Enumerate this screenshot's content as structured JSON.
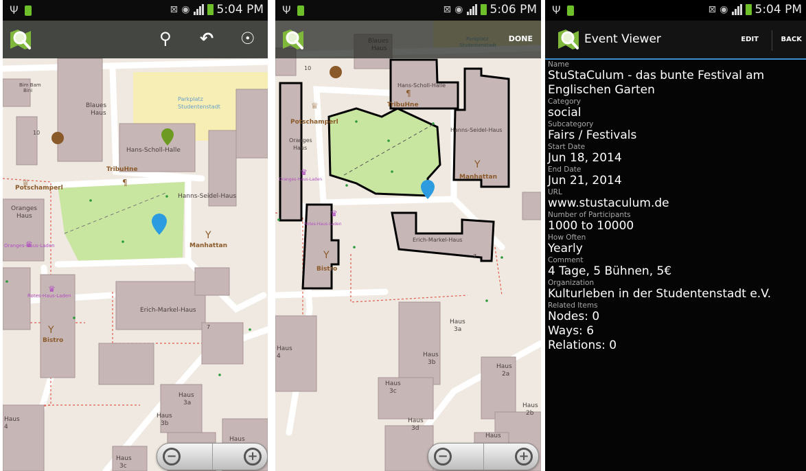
{
  "status_bar": [
    {
      "time": "5:04 PM"
    },
    {
      "time": "5:06 PM"
    },
    {
      "time": "5:04 PM"
    }
  ],
  "editor_toolbar": {
    "done_label": "DONE"
  },
  "map_labels": {
    "bim_bam": "Bim Bam",
    "bim_bam2": "Bini",
    "blaues": "Blaues",
    "haus": "Haus",
    "parkplatz": "Parkplatz",
    "studentenstadt": "Studentenstadt",
    "hans_scholl": "Hans-Scholl-Halle",
    "tribuhne": "TribuHne",
    "potschamperl": "Potschamperl",
    "oranges": "Oranges",
    "oranges_laden": "Oranges-Haus-Laden",
    "hanns_seidel": "Hanns-Seidel-Haus",
    "manhattan": "Manhattan",
    "rotes_laden": "Rotes-Haus-Laden",
    "erich_markel": "Erich-Markel-Haus",
    "bistro": "Bistro",
    "num_10": "10",
    "num_7": "7",
    "num_4": "4",
    "h3a": "3a",
    "h3b": "3b",
    "h3c": "3c",
    "h3d": "3d",
    "h2a": "2a",
    "h2b": "2b"
  },
  "event_viewer": {
    "title": "Event Viewer",
    "edit_label": "EDIT",
    "back_label": "BACK",
    "fields": [
      {
        "label": "Name",
        "value": "StuStaCulum - das bunte Festival am Englischen Garten"
      },
      {
        "label": "Category",
        "value": "social"
      },
      {
        "label": "Subcategory",
        "value": "Fairs / Festivals"
      },
      {
        "label": "Start Date",
        "value": "Jun 18, 2014"
      },
      {
        "label": "End Date",
        "value": "Jun 21, 2014"
      },
      {
        "label": "URL",
        "value": "www.stustaculum.de"
      },
      {
        "label": "Number of Participants",
        "value": "1000 to 10000"
      },
      {
        "label": "How Often",
        "value": "Yearly"
      },
      {
        "label": "Comment",
        "value": "4 Tage, 5 Bühnen, 5€"
      },
      {
        "label": "Organization",
        "value": "Kulturleben in der Studentenstadt e.V."
      },
      {
        "label": "Related Items",
        "value": "Nodes: 0"
      }
    ],
    "related_extra": [
      "Ways: 6",
      "Relations: 0"
    ]
  },
  "colors": {
    "building": "#c7b6b6",
    "park": "#c8e6a0",
    "parking": "#f6eeb4",
    "road": "#ffffff",
    "pin_blue": "#2d9be0",
    "pin_green": "#6c9a22",
    "selection": "#000000",
    "accent": "#3c8fd0"
  },
  "icons": {
    "search": "search-icon",
    "undo": "undo-icon",
    "locate": "locate-icon",
    "zoom_out": "zoom-out-icon",
    "zoom_in": "zoom-in-icon"
  }
}
